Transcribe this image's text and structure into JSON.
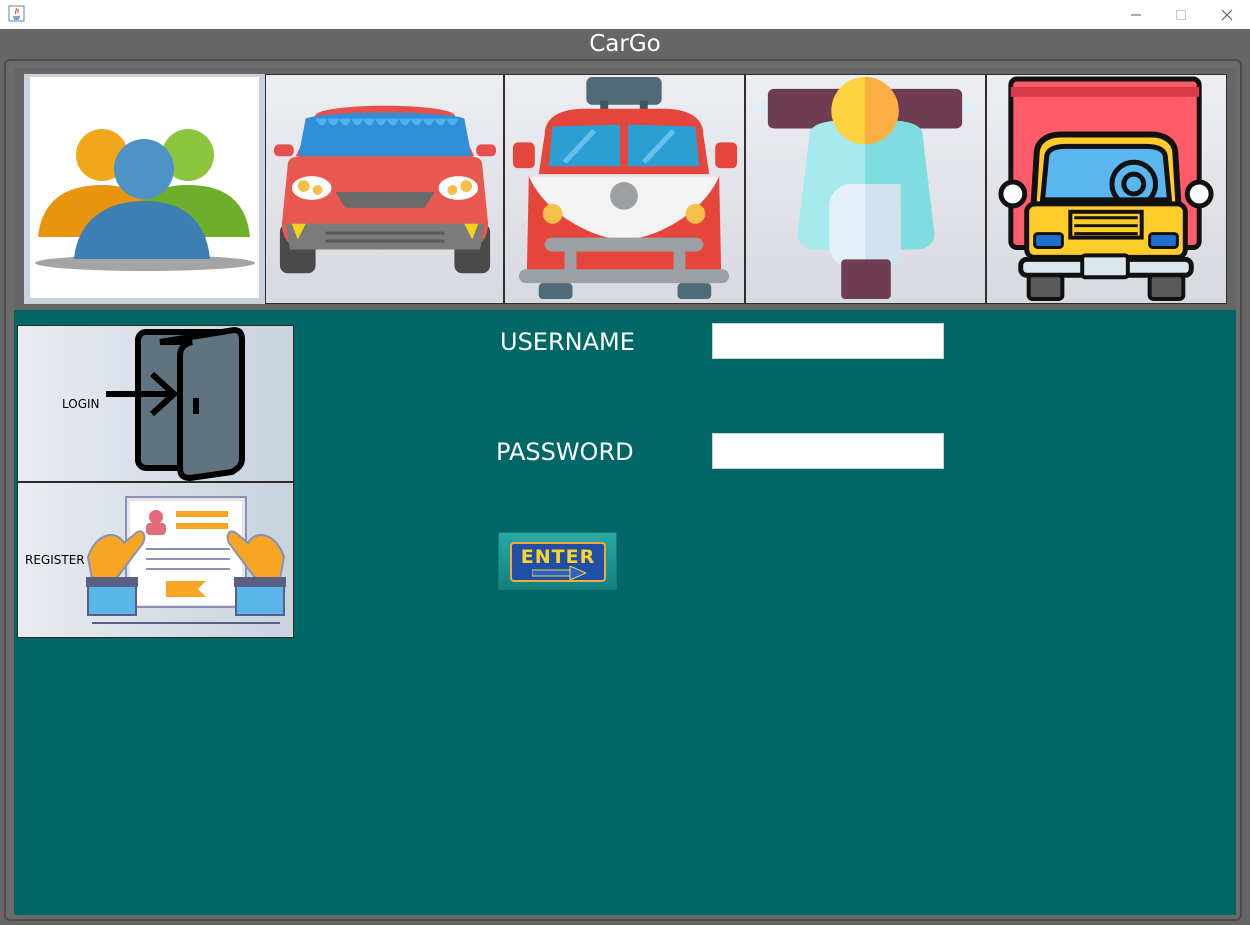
{
  "window": {
    "title": "CarGo",
    "controls": [
      "minimize-icon",
      "maximize-icon",
      "close-icon"
    ]
  },
  "toolbar": {
    "items": [
      {
        "name": "users",
        "icon": "users-group-icon",
        "selected": true
      },
      {
        "name": "car",
        "icon": "car-icon",
        "selected": false
      },
      {
        "name": "van",
        "icon": "van-icon",
        "selected": false
      },
      {
        "name": "scooter",
        "icon": "scooter-icon",
        "selected": false
      },
      {
        "name": "truck",
        "icon": "truck-icon",
        "selected": false
      }
    ]
  },
  "sidebar": {
    "login_label": "LOGIN",
    "register_label": "REGISTER"
  },
  "form": {
    "username_label": "USERNAME",
    "password_label": "PASSWORD",
    "username_value": "",
    "password_value": "",
    "enter_label": "ENTER"
  },
  "colors": {
    "panel": "#006666",
    "frame": "#666666",
    "title_text": "#ffffff"
  }
}
